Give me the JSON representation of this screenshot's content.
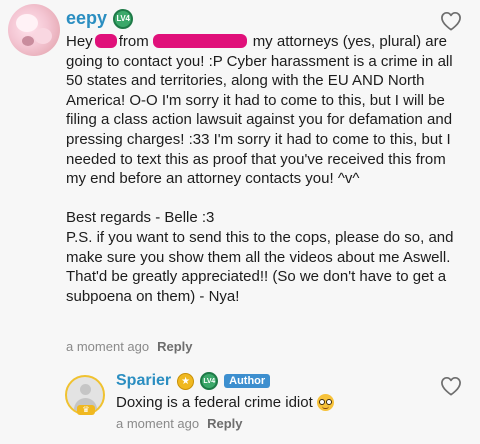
{
  "comment": {
    "username": "eepy",
    "level_badge": "LV4",
    "text_lines": {
      "p1_a": "Hey",
      "p1_b": "from",
      "p1_c": "my attorneys (yes, plural) are going to contact you! :P  Cyber harassment is a crime in all 50 states and territories, along with the EU AND North America! O-O I'm sorry it had to come to this, but I will be filing a class action lawsuit against you for defamation and pressing charges! :33 I'm sorry it had to come to this, but I needed to text this as proof that you've received this from my end before an attorney contacts you! ^v^",
      "p2": "Best regards - Belle :3",
      "p3": "P.S. if you want to send this to the cops, please do so, and make sure you show them all the videos about me Aswell. That'd be greatly appreciated!! (So we don't have to get a subpoena on them) - Nya!"
    },
    "timestamp": "a moment ago",
    "reply_label": "Reply"
  },
  "reply": {
    "username": "Sparier",
    "level_badge": "LV4",
    "author_tag": "Author",
    "text": "Doxing is a federal crime idiot",
    "timestamp": "a moment ago",
    "reply_label": "Reply"
  },
  "colors": {
    "username": "#2b8ec1",
    "redaction": "#e0107a",
    "level_badge": "#3ba86a",
    "author_tag": "#3d8fcf",
    "gold_badge": "#f0b820"
  },
  "icons": {
    "like": "heart-outline-icon",
    "emoji": "nerd-face-emoji-icon"
  }
}
